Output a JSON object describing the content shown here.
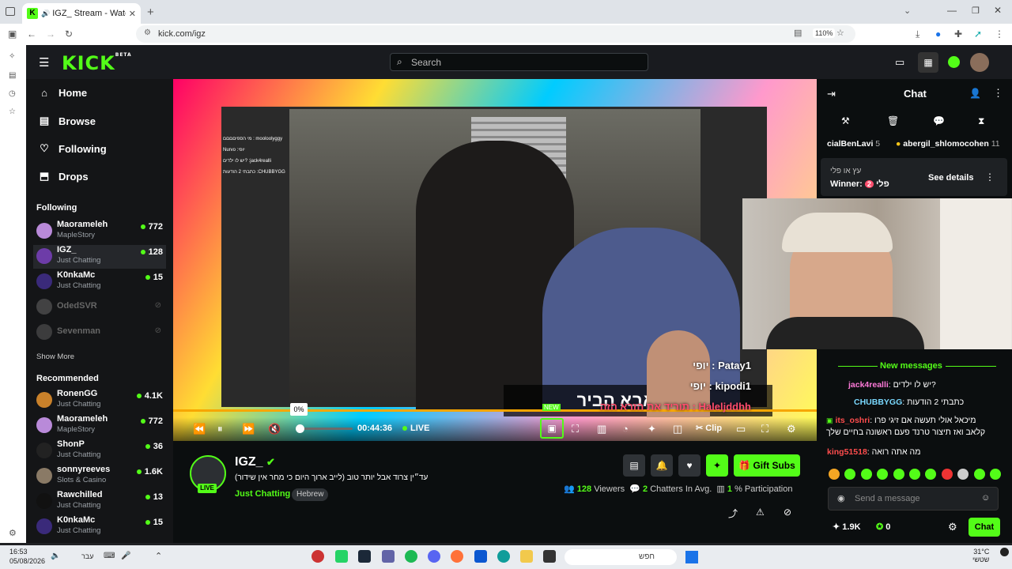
{
  "browser": {
    "tab_title": "IGZ_ Stream - Watch Live o",
    "url": "kick.com/igz",
    "zoom": "110%"
  },
  "header": {
    "logo": "KICK",
    "logo_badge": "BETA",
    "search_placeholder": "Search"
  },
  "sidebar": {
    "nav": [
      {
        "label": "Home",
        "icon": "home-icon"
      },
      {
        "label": "Browse",
        "icon": "browse-icon"
      },
      {
        "label": "Following",
        "icon": "heart-icon"
      },
      {
        "label": "Drops",
        "icon": "drops-icon"
      }
    ],
    "following_title": "Following",
    "following": [
      {
        "name": "Maorameleh",
        "category": "MapleStory",
        "count": "772",
        "avatar_color": "#b98ad9"
      },
      {
        "name": "IGZ_",
        "category": "Just Chatting",
        "count": "128",
        "avatar_color": "#6d3ca8"
      },
      {
        "name": "K0nkaMc",
        "category": "Just Chatting",
        "count": "15",
        "avatar_color": "#3a2a7a"
      },
      {
        "name": "OdedSVR",
        "category": "",
        "count": "",
        "avatar_color": "#888"
      },
      {
        "name": "Sevenman",
        "category": "",
        "count": "",
        "avatar_color": "#777"
      }
    ],
    "show_more": "Show More",
    "recommended_title": "Recommended",
    "recommended": [
      {
        "name": "RonenGG",
        "category": "Just Chatting",
        "count": "4.1K",
        "avatar_color": "#c9812a"
      },
      {
        "name": "Maorameleh",
        "category": "MapleStory",
        "count": "772",
        "avatar_color": "#b98ad9"
      },
      {
        "name": "ShonP",
        "category": "Just Chatting",
        "count": "36",
        "avatar_color": "#222"
      },
      {
        "name": "sonnyreeves",
        "category": "Slots & Casino",
        "count": "1.6K",
        "avatar_color": "#8a7a66"
      },
      {
        "name": "Rawchilled",
        "category": "Just Chatting",
        "count": "13",
        "avatar_color": "#111"
      },
      {
        "name": "K0nkaMc",
        "category": "Just Chatting",
        "count": "15",
        "avatar_color": "#3a2a7a"
      }
    ]
  },
  "player": {
    "volume_tip": "0%",
    "time": "00:44:36",
    "live": "LIVE",
    "clip": "Clip",
    "subtitle": "יו את אבא הביר",
    "new_badge": "NEW",
    "overlay_chat": [
      "מי הספיםםםם : mooloolyggy",
      "Nurvo :יופי",
      "יש לו ילדים? :jack4realli",
      "כתבתי 2 הודעות :CHUBBYGG"
    ]
  },
  "stream_overlay_chat": [
    {
      "text": "יופי : Patay1"
    },
    {
      "text": "יופי : kipodi1"
    },
    {
      "text": "תוריד את הזרא הזה : Haleljddhh"
    }
  ],
  "chat": {
    "title": "Chat",
    "top_gifters": [
      {
        "name": "cialBenLavi",
        "count": "5"
      },
      {
        "name": "abergil_shlomocohen",
        "count": "11"
      }
    ],
    "pinned_question": "עץ או פלי",
    "pinned_winner_label": "Winner:",
    "pinned_winner_num": "2",
    "pinned_winner_value": "פלי",
    "see_details": "See details",
    "new_messages": "New messages",
    "messages": [
      {
        "user": "jack4realli",
        "text": "יש לו ילדים?",
        "color": "#ff7ad9"
      },
      {
        "user": "CHUBBYGG",
        "text": "כתבתי 2 הודעות",
        "color": "#7ad9ff"
      },
      {
        "user": "its_oshri",
        "text": "מיכאל אולי תעשה אם זיגי פרו קלאב ואז תיצור טרנד פעם ראשונה בחיים שלך",
        "color": "#ff4d4d"
      },
      {
        "user": "king51518",
        "text": "מה אתה רואה",
        "color": "#ff4d4d"
      }
    ],
    "input_placeholder": "Send a message",
    "points": "1.9K",
    "kicks": "0",
    "chat_button": "Chat"
  },
  "stream_info": {
    "streamer": "IGZ_",
    "live_badge": "LIVE",
    "title": "עד״ין צרוד אבל יותר טוב (לייב ארוך היום כי מחר אין שידור)",
    "category": "Just Chatting",
    "language": "Hebrew",
    "gift_subs": "Gift Subs",
    "viewers": "128",
    "viewers_label": "Viewers",
    "chatters": "2",
    "chatters_label": "Chatters In Avg.",
    "participation": "1",
    "participation_label": "% Participation"
  },
  "taskbar": {
    "time": "16:53",
    "date": "05/08/2026",
    "lang": "עבר",
    "search": "חפש",
    "weather": "31°C",
    "weather_sub": "שטשי"
  },
  "colors": {
    "brand": "#53fc18",
    "background": "#0b0e0f"
  }
}
